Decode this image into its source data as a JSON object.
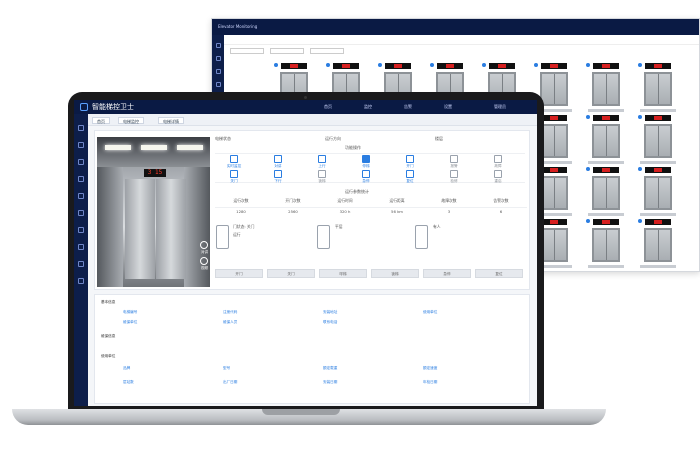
{
  "back_window": {
    "title": "Elevator Monitoring"
  },
  "laptop_app": {
    "title": "智能梯控卫士",
    "top_links": [
      "首页",
      "监控",
      "告警",
      "设置"
    ],
    "user": "管理员",
    "tabs": [
      "首页",
      "电梯监控",
      "电梯详情"
    ],
    "floor_display": "3 15",
    "car_controls": [
      "对讲",
      "视频"
    ],
    "info_row": [
      "电梯状态",
      "运行方向",
      "楼层"
    ],
    "section_title": "功能操作",
    "icon_buttons": [
      {
        "label": "实时监控",
        "style": "blue"
      },
      {
        "label": "对讲",
        "style": "blue"
      },
      {
        "label": "上行",
        "style": "blue"
      },
      {
        "label": "停梯",
        "style": "fill"
      },
      {
        "label": "开门",
        "style": "blue"
      },
      {
        "label": "报警",
        "style": "gray"
      },
      {
        "label": "故障",
        "style": "gray"
      },
      {
        "label": "关门",
        "style": "blue"
      },
      {
        "label": "下行",
        "style": "blue"
      },
      {
        "label": "锁梯",
        "style": "gray"
      },
      {
        "label": "急停",
        "style": "blue"
      },
      {
        "label": "复位",
        "style": "blue"
      },
      {
        "label": "检修",
        "style": "gray"
      },
      {
        "label": "重启",
        "style": "gray"
      }
    ],
    "table_title": "运行参数统计",
    "table_headers": [
      "运行次数",
      "开门次数",
      "运行时间",
      "运行距离",
      "故障次数",
      "告警次数"
    ],
    "table_values": [
      "1280",
      "2560",
      "320 h",
      "56 km",
      "3",
      "6"
    ],
    "status_block": {
      "label_a": "门状态: 关门",
      "label_b": "运行",
      "label_c": "平层",
      "label_d": "有人"
    },
    "buttons": [
      "开门",
      "关门",
      "呼梯",
      "锁梯",
      "急停",
      "复位"
    ],
    "bottom": {
      "section1": "基本信息",
      "section2": "维保信息",
      "section3": "使用单位",
      "rows": [
        [
          "电梯编号",
          "注册代码",
          "安装地址",
          "使用单位"
        ],
        [
          "维保单位",
          "维保人员",
          "联系电话"
        ],
        [
          "品牌",
          "型号",
          "额定载重",
          "额定速度"
        ],
        [
          "层站数",
          "出厂日期",
          "安装日期",
          "年检日期"
        ]
      ]
    }
  }
}
